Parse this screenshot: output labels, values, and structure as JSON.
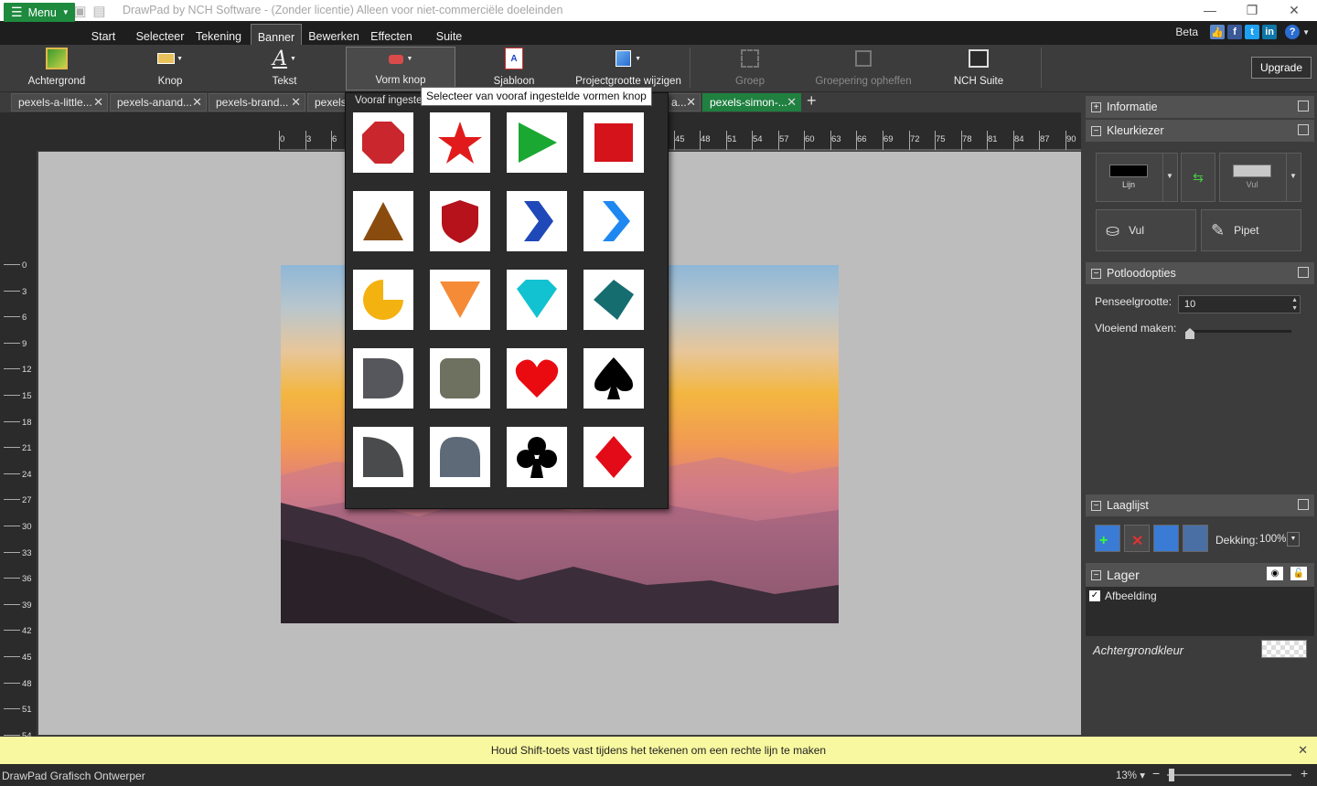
{
  "window": {
    "title": "DrawPad by NCH Software - (Zonder licentie) Alleen voor niet-commerciële doeleinden"
  },
  "menu": {
    "menu_label": "Menu",
    "tabs": [
      "Start",
      "Selecteer",
      "Tekening",
      "Banner",
      "Bewerken",
      "Effecten",
      "Suite"
    ],
    "active_tab": "Banner",
    "beta": "Beta"
  },
  "ribbon": {
    "achtergrond": "Achtergrond",
    "knop": "Knop",
    "tekst": "Tekst",
    "vorm_knop": "Vorm knop",
    "sjabloon": "Sjabloon",
    "projectgrootte": "Projectgrootte wijzigen",
    "groep": "Groep",
    "groepering_opheffen": "Groepering opheffen",
    "nch_suite": "NCH Suite",
    "upgrade": "Upgrade"
  },
  "doc_tabs": [
    "pexels-a-little...",
    "pexels-anand...",
    "pexels-brand...",
    "pexels",
    "a...",
    "pexels-simon-..."
  ],
  "ruler": {
    "h_ticks": [
      "0",
      "3",
      "6",
      "45",
      "48",
      "51",
      "54",
      "57",
      "60",
      "63",
      "66",
      "69",
      "72",
      "75",
      "78",
      "81",
      "84",
      "87",
      "90"
    ],
    "v_ticks": [
      "0",
      "3",
      "6",
      "9",
      "12",
      "15",
      "18",
      "21",
      "24",
      "27",
      "30",
      "33",
      "36",
      "39",
      "42",
      "45",
      "48",
      "51",
      "54"
    ]
  },
  "dropdown": {
    "header": "Vooraf ingeste",
    "tooltip": "Selecteer van vooraf ingestelde vormen knop",
    "shapes": [
      "octagon-red",
      "star-red",
      "play-green",
      "square-red",
      "triangle-brown",
      "shield-red",
      "chevron-blue-dark",
      "chevron-blue-light",
      "pacman-yellow",
      "triangle-down-orange",
      "diamond-cyan",
      "diamond-teal",
      "d-shape-grey",
      "rounded-square-olive",
      "heart-red",
      "spade-black",
      "quarter-circle-grey",
      "rounded-tab-slate",
      "club-black",
      "diamond-red"
    ]
  },
  "panel": {
    "informatie": "Informatie",
    "kleurkiezer": "Kleurkiezer",
    "lijn": "Lijn",
    "vul_small": "Vul",
    "vul": "Vul",
    "pipet": "Pipet",
    "potloodopties": "Potloodopties",
    "penseelgrootte_label": "Penseelgrootte:",
    "penseelgrootte_value": "10",
    "vloeiend_label": "Vloeiend maken:",
    "laaglijst": "Laaglijst",
    "dekking_label": "Dekking:",
    "dekking_value": "100%",
    "lager": "Lager",
    "layer_name": "Afbeelding",
    "achtergrondkleur": "Achtergrondkleur"
  },
  "status": {
    "hint": "Houd Shift-toets vast tijdens het tekenen om een rechte lijn te maken",
    "app": "DrawPad Grafisch Ontwerper",
    "zoom": "13% ▾"
  },
  "colors": {
    "accent": "#1e8a3e",
    "line": "#000000",
    "fill": "#c8c8c8"
  }
}
